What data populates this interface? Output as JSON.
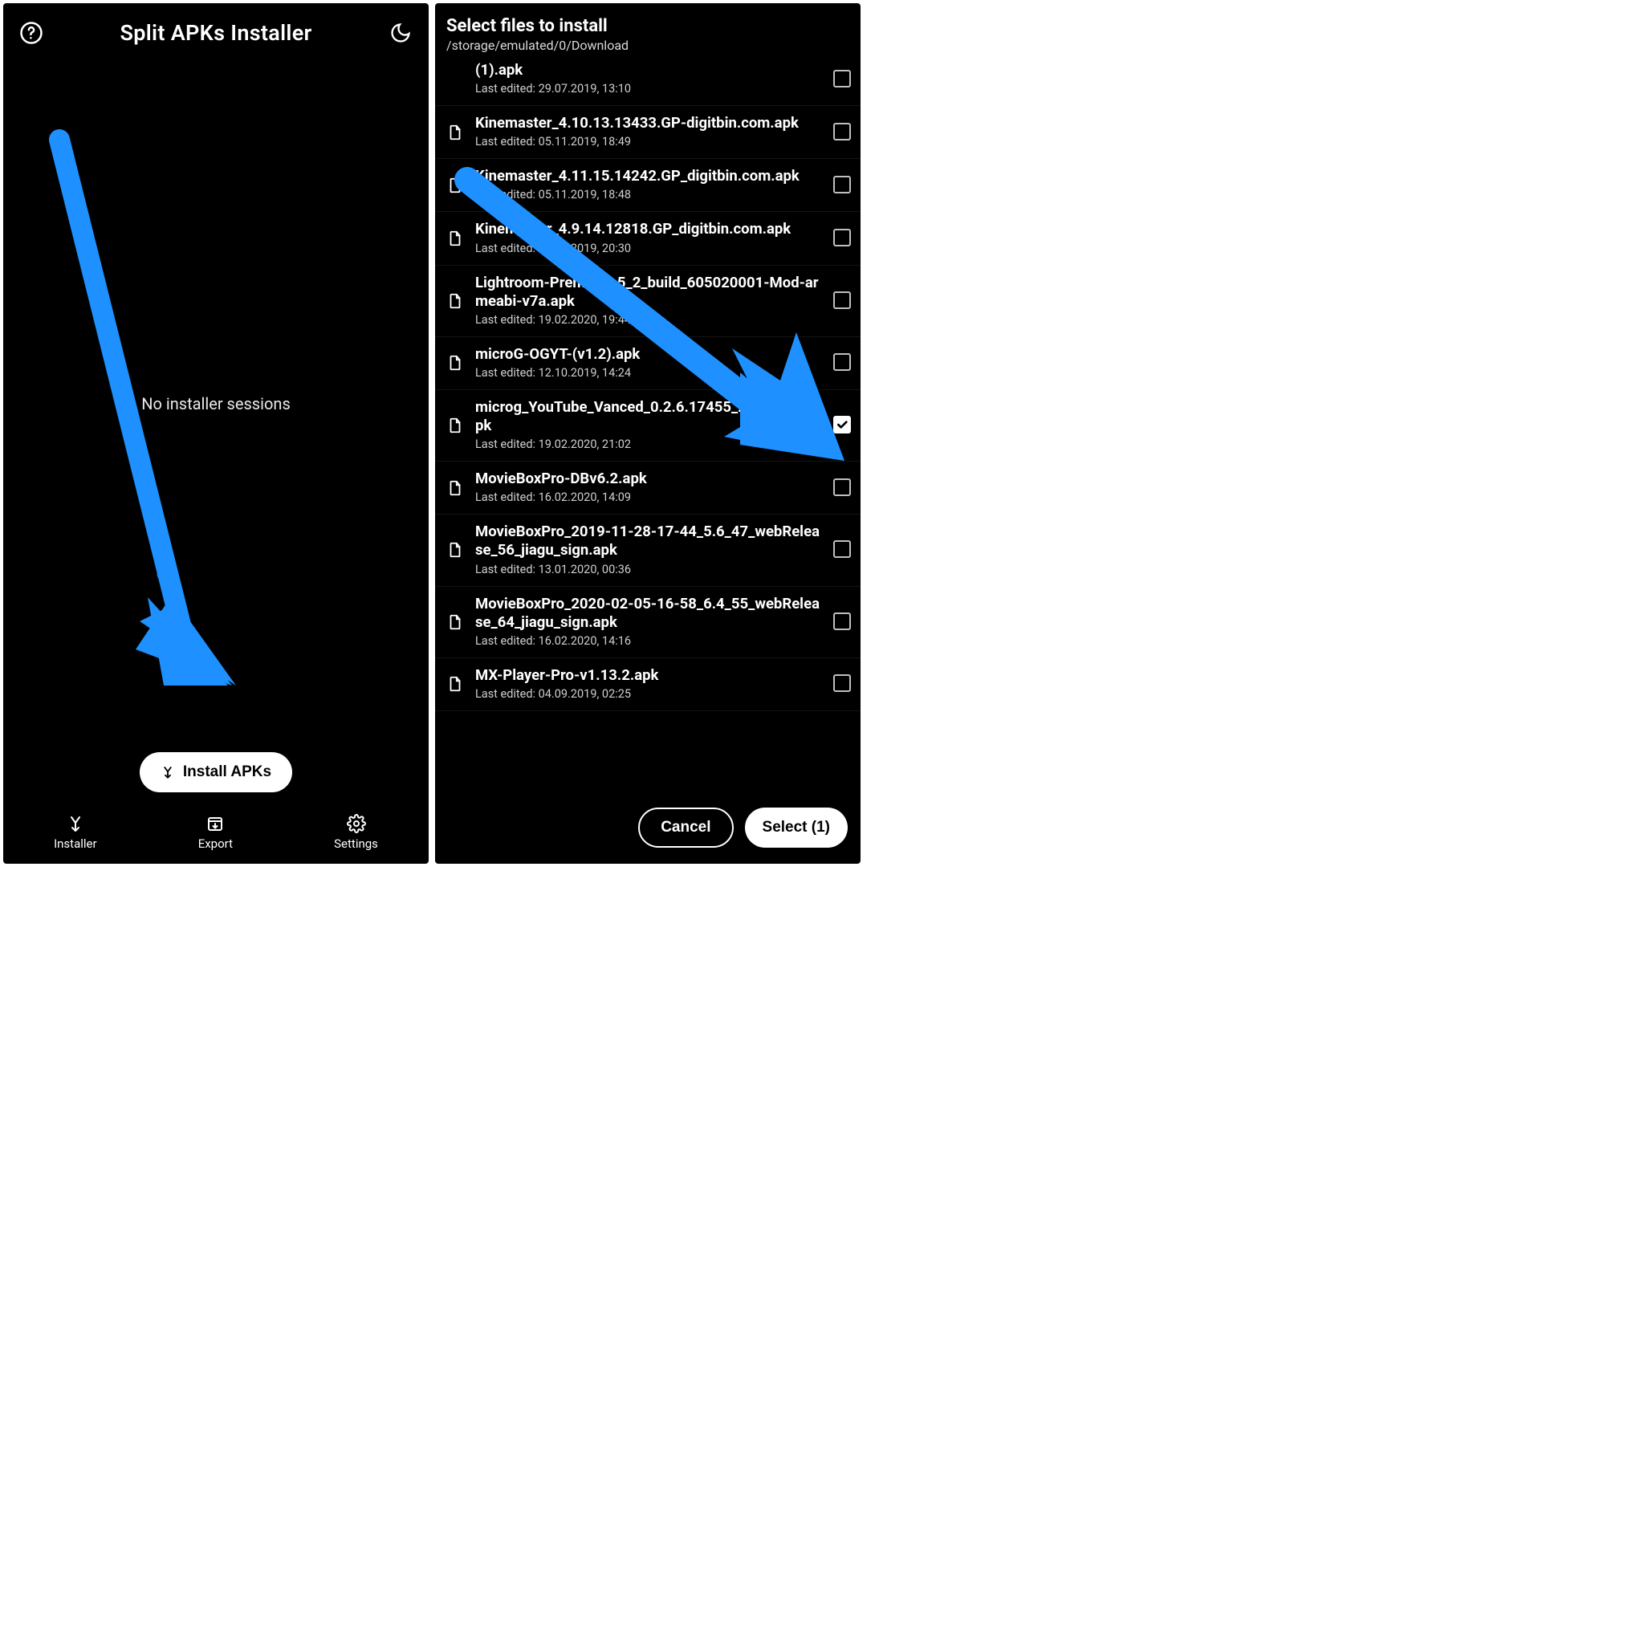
{
  "left": {
    "title": "Split APKs Installer",
    "empty_text": "No installer sessions",
    "install_button": "Install APKs",
    "nav": {
      "installer": "Installer",
      "export": "Export",
      "settings": "Settings"
    }
  },
  "right": {
    "title": "Select files to install",
    "path": "/storage/emulated/0/Download",
    "last_edited_prefix": "Last edited: ",
    "cancel": "Cancel",
    "select_label": "Select (1)",
    "files": [
      {
        "name": "(1).apk",
        "meta": "29.07.2019, 13:10",
        "checked": false,
        "hasIcon": false
      },
      {
        "name": "Kinemaster_4.10.13.13433.GP-digitbin.com.apk",
        "meta": "05.11.2019, 18:49",
        "checked": false,
        "hasIcon": true
      },
      {
        "name": "Kinemaster_4.11.15.14242.GP_digitbin.com.apk",
        "meta": "05.11.2019, 18:48",
        "checked": false,
        "hasIcon": true
      },
      {
        "name": "Kinemaster_4.9.14.12818.GP_digitbin.com.apk",
        "meta": "05.11.2019, 20:30",
        "checked": false,
        "hasIcon": true
      },
      {
        "name": "Lightroom-Premium_5_2_build_605020001-Mod-armeabi-v7a.apk",
        "meta": "19.02.2020, 19:44",
        "checked": false,
        "hasIcon": true
      },
      {
        "name": "microG-OGYT-(v1.2).apk",
        "meta": "12.10.2019, 14:24",
        "checked": false,
        "hasIcon": true
      },
      {
        "name": "microg_YouTube_Vanced_0.2.6.17455_28052019.apk",
        "meta": "19.02.2020, 21:02",
        "checked": true,
        "hasIcon": true
      },
      {
        "name": "MovieBoxPro-DBv6.2.apk",
        "meta": "16.02.2020, 14:09",
        "checked": false,
        "hasIcon": true
      },
      {
        "name": "MovieBoxPro_2019-11-28-17-44_5.6_47_webRelease_56_jiagu_sign.apk",
        "meta": "13.01.2020, 00:36",
        "checked": false,
        "hasIcon": true
      },
      {
        "name": "MovieBoxPro_2020-02-05-16-58_6.4_55_webRelease_64_jiagu_sign.apk",
        "meta": "16.02.2020, 14:16",
        "checked": false,
        "hasIcon": true
      },
      {
        "name": "MX-Player-Pro-v1.13.2.apk",
        "meta": "04.09.2019, 02:25",
        "checked": false,
        "hasIcon": true
      }
    ]
  },
  "colors": {
    "arrow": "#1E90FF"
  }
}
